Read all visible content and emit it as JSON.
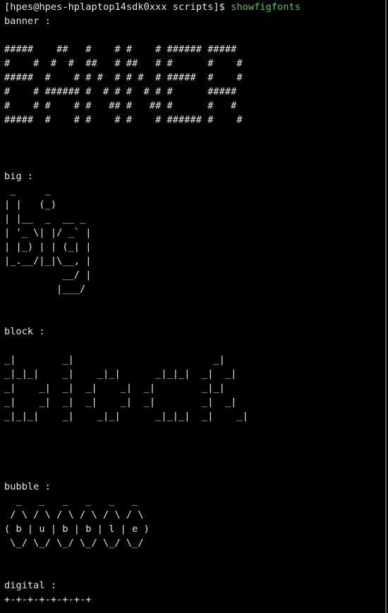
{
  "terminal": {
    "prompt": "[hpes@hpes-hplaptop14sdk0xxx scripts]$ ",
    "command": "showfigfonts",
    "colors": {
      "background": "#000000",
      "foreground": "#e6e6e6",
      "command": "#4ec94e",
      "border": "#5a5a5a"
    },
    "banner": {
      "label": "banner :",
      "art": [
        "#####    ##   #    # #    # ###### #####",
        "#    #  #  #  ##   # ##   # #      #    #",
        "#####  #    # # #  # # #  # #####  #    #",
        "#    # ###### #  # # #  # # #      #####",
        "#    # #    # #   ## #   ## #      #   #",
        "#####  #    # #    # #    # ###### #    #"
      ]
    },
    "big": {
      "label": "big :",
      "art": [
        " _     _",
        "| |   (_)",
        "| |__  _  __ _",
        "| '_ \\| |/ _` |",
        "| |_) | | (_| |",
        "|_.__/|_|\\__, |",
        "          __/ |",
        "         |___/"
      ]
    },
    "block": {
      "label": "block :",
      "art": [
        "_|        _|                        _|",
        "_|_|_|    _|    _|_|      _|_|_|  _|  _|",
        "_|    _|  _|  _|    _|  _|        _|_|",
        "_|    _|  _|  _|    _|  _|        _|  _|",
        "_|_|_|    _|    _|_|      _|_|_|  _|    _|"
      ]
    },
    "bubble": {
      "label": "bubble :",
      "art": [
        "  _   _   _   _   _   _",
        " / \\ / \\ / \\ / \\ / \\ / \\",
        "( b | u | b | b | l | e )",
        " \\_/ \\_/ \\_/ \\_/ \\_/ \\_/"
      ]
    },
    "digital": {
      "label": "digital :",
      "art": [
        "+-+-+-+-+-+-+-+"
      ]
    }
  }
}
